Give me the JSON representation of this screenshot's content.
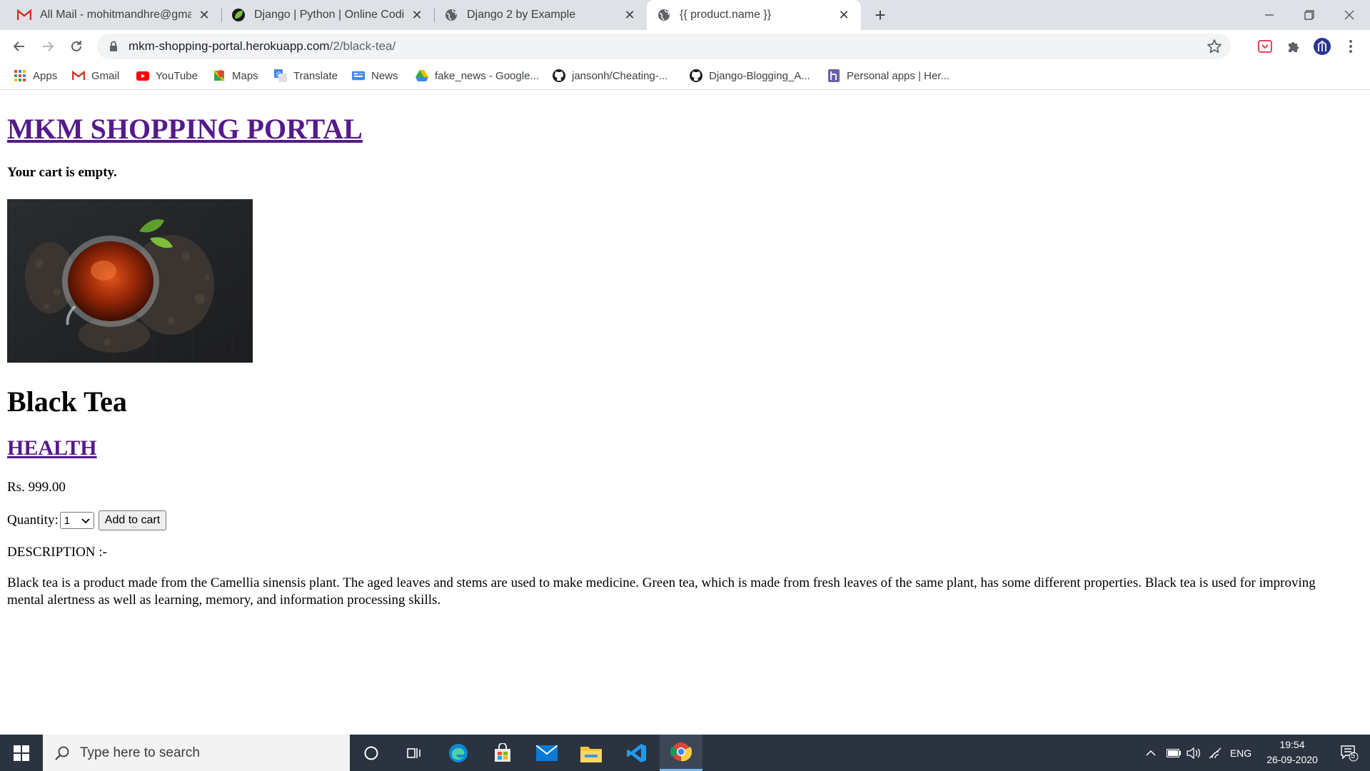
{
  "browser": {
    "tabs": [
      {
        "title": "All Mail - mohitmandhre@gmail.",
        "icon": "gmail-icon"
      },
      {
        "title": "Django | Python | Online Coding",
        "icon": "leaf-icon"
      },
      {
        "title": "Django 2 by Example",
        "icon": "globe-icon"
      },
      {
        "title": "{{ product.name }}",
        "icon": "globe-icon",
        "active": true
      }
    ],
    "url": {
      "host": "mkm-shopping-portal.herokuapp.com",
      "path": "/2/black-tea/"
    },
    "bookmarks": [
      {
        "label": "Apps",
        "icon": "apps-grid-icon"
      },
      {
        "label": "Gmail",
        "icon": "gmail-icon"
      },
      {
        "label": "YouTube",
        "icon": "youtube-icon"
      },
      {
        "label": "Maps",
        "icon": "maps-icon"
      },
      {
        "label": "Translate",
        "icon": "translate-icon"
      },
      {
        "label": "News",
        "icon": "news-icon"
      },
      {
        "label": "fake_news - Google...",
        "icon": "drive-icon"
      },
      {
        "label": "jansonh/Cheating-...",
        "icon": "github-icon"
      },
      {
        "label": "Django-Blogging_A...",
        "icon": "github-icon"
      },
      {
        "label": "Personal apps | Her...",
        "icon": "heroku-icon"
      }
    ]
  },
  "page": {
    "site_title": "MKM SHOPPING PORTAL",
    "cart_status": "Your cart is empty.",
    "product_name": "Black Tea",
    "category": "HEALTH",
    "price": "Rs. 999.00",
    "quantity_label": "Quantity:",
    "quantity_value": "1",
    "add_to_cart": "Add to cart",
    "description_heading": "DESCRIPTION :-",
    "description": "Black tea is a product made from the Camellia sinensis plant. The aged leaves and stems are used to make medicine. Green tea, which is made from fresh leaves of the same plant, has some different properties. Black tea is used for improving mental alertness as well as learning, memory, and information processing skills."
  },
  "taskbar": {
    "search_placeholder": "Type here to search",
    "language": "ENG",
    "time": "19:54",
    "date": "26-09-2020",
    "notifications": "5"
  },
  "colors": {
    "visited_link": "#551a8b",
    "tabstrip": "#dee1e6",
    "taskbar": "#2b3340"
  }
}
